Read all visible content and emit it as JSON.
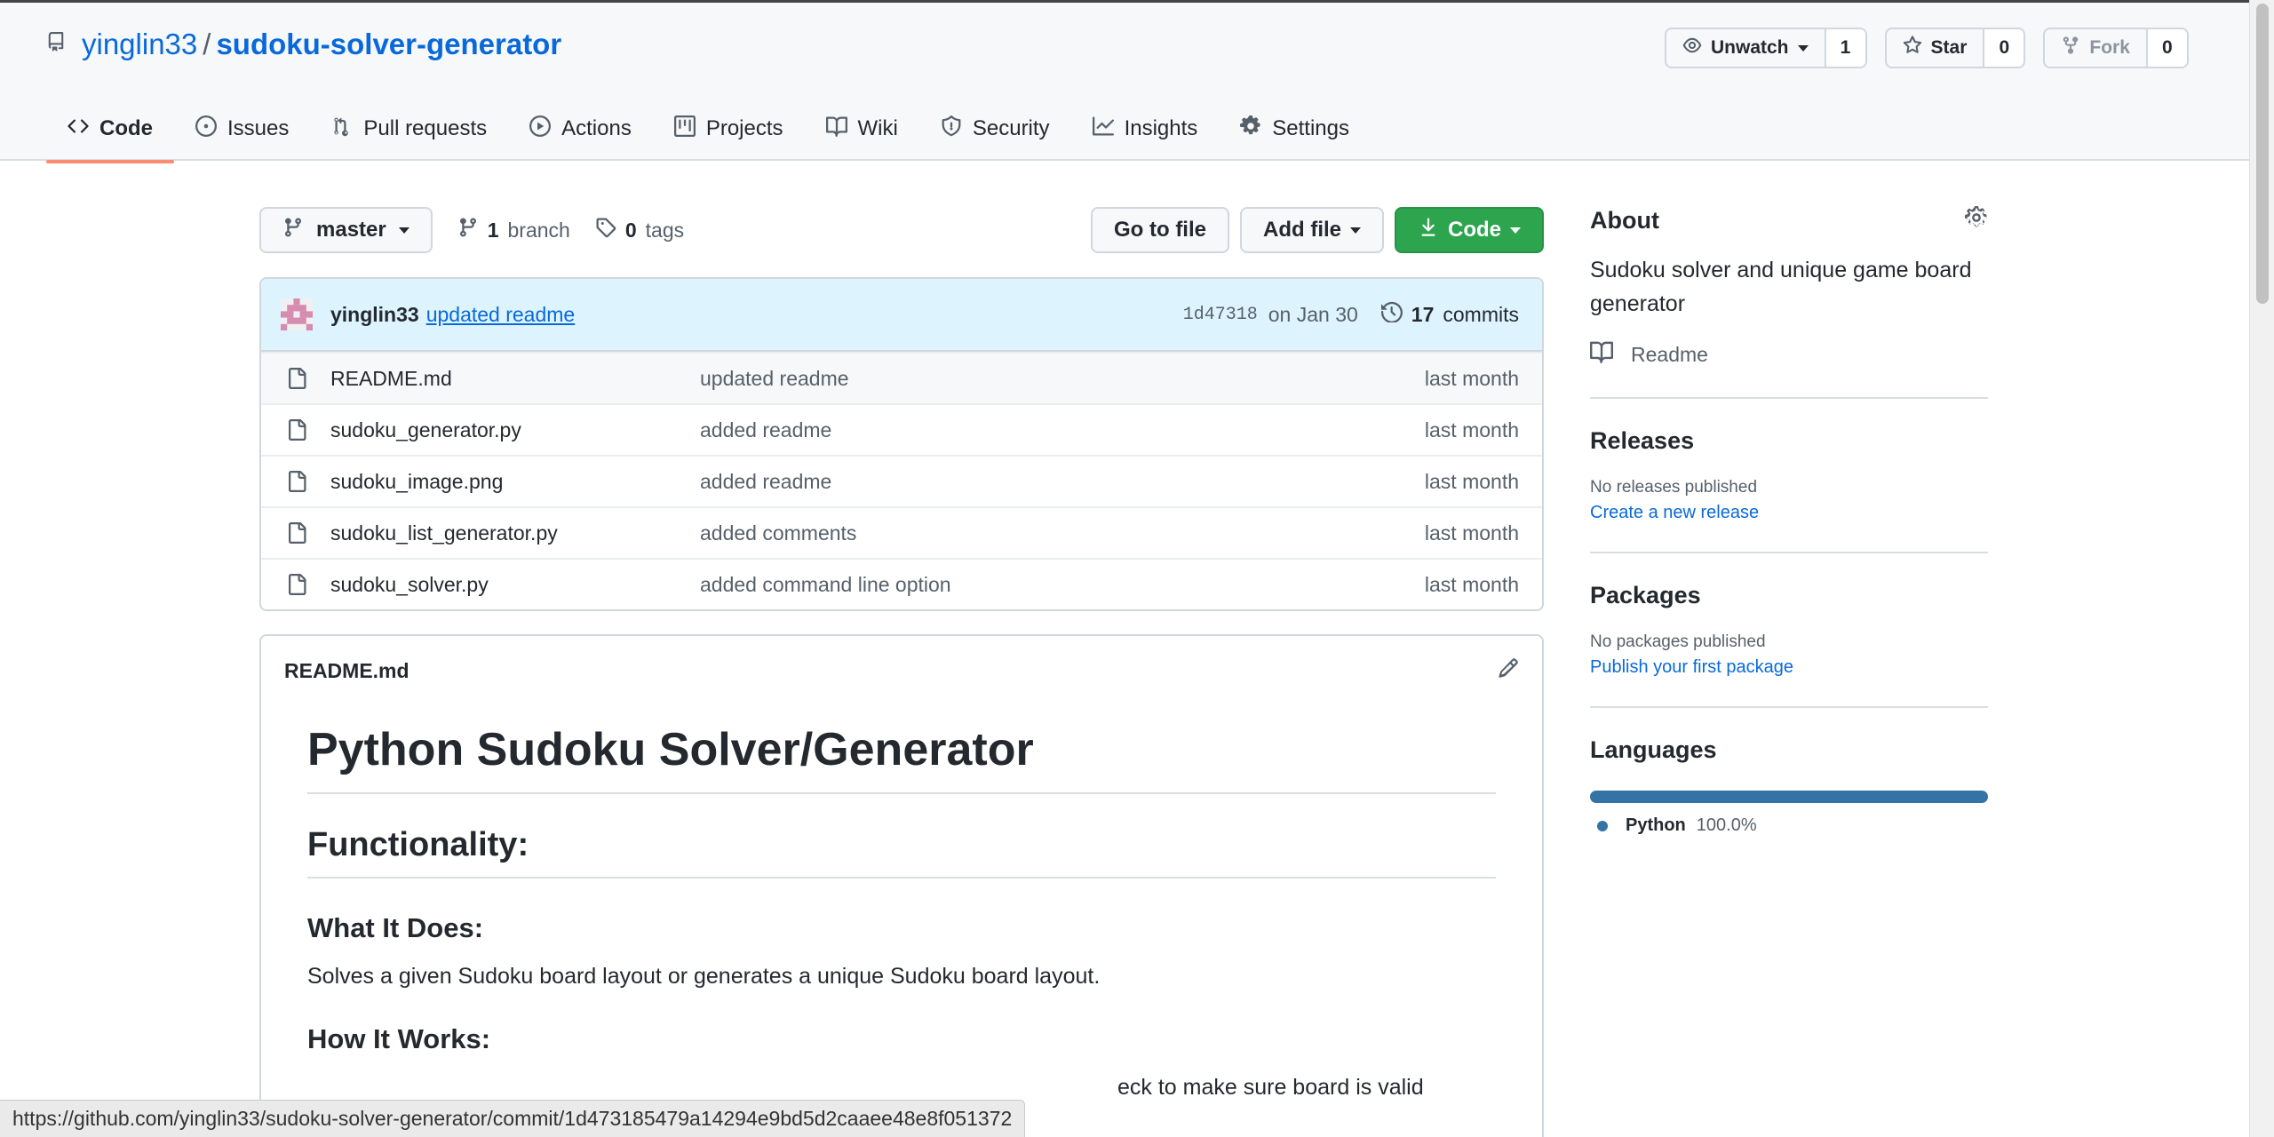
{
  "repo": {
    "owner": "yinglin33",
    "separator": "/",
    "name": "sudoku-solver-generator"
  },
  "header_actions": {
    "watch": {
      "label": "Unwatch",
      "count": "1"
    },
    "star": {
      "label": "Star",
      "count": "0"
    },
    "fork": {
      "label": "Fork",
      "count": "0"
    }
  },
  "tabs": [
    {
      "label": "Code",
      "icon": "code-icon"
    },
    {
      "label": "Issues",
      "icon": "issue-icon"
    },
    {
      "label": "Pull requests",
      "icon": "pull-request-icon"
    },
    {
      "label": "Actions",
      "icon": "play-icon"
    },
    {
      "label": "Projects",
      "icon": "project-icon"
    },
    {
      "label": "Wiki",
      "icon": "book-icon"
    },
    {
      "label": "Security",
      "icon": "shield-icon"
    },
    {
      "label": "Insights",
      "icon": "graph-icon"
    },
    {
      "label": "Settings",
      "icon": "gear-icon"
    }
  ],
  "toolbar": {
    "branch": "master",
    "branches_count": "1",
    "branches_label": "branch",
    "tags_count": "0",
    "tags_label": "tags",
    "go_to_file": "Go to file",
    "add_file": "Add file",
    "code": "Code"
  },
  "commit": {
    "author": "yinglin33",
    "message": "updated readme",
    "sha": "1d47318",
    "date": "on Jan 30",
    "commits_count": "17",
    "commits_label": "commits"
  },
  "files": [
    {
      "name": "README.md",
      "message": "updated readme",
      "time": "last month"
    },
    {
      "name": "sudoku_generator.py",
      "message": "added readme",
      "time": "last month"
    },
    {
      "name": "sudoku_image.png",
      "message": "added readme",
      "time": "last month"
    },
    {
      "name": "sudoku_list_generator.py",
      "message": "added comments",
      "time": "last month"
    },
    {
      "name": "sudoku_solver.py",
      "message": "added command line option",
      "time": "last month"
    }
  ],
  "readme": {
    "filename": "README.md",
    "h1": "Python Sudoku Solver/Generator",
    "h2": "Functionality:",
    "h3_what": "What It Does:",
    "p_what": "Solves a given Sudoku board layout or generates a unique Sudoku board layout.",
    "h3_how": "How It Works:",
    "p_cut": "eck to make sure board is valid"
  },
  "sidebar": {
    "about_title": "About",
    "about_text": "Sudoku solver and unique game board generator",
    "readme_link": "Readme",
    "releases_title": "Releases",
    "releases_none": "No releases published",
    "releases_link": "Create a new release",
    "packages_title": "Packages",
    "packages_none": "No packages published",
    "packages_link": "Publish your first package",
    "languages_title": "Languages",
    "language_name": "Python",
    "language_pct": "100.0%",
    "language_share": 1.0,
    "language_color": "#3572A5"
  },
  "status_url": "https://github.com/yinglin33/sudoku-solver-generator/commit/1d473185479a14294e9bd5d2caaee48e8f051372",
  "colors": {
    "link": "#0969da",
    "accent_tab": "#fd8c73",
    "green_button": "#2da44e",
    "commit_bar": "#ddf4ff"
  }
}
